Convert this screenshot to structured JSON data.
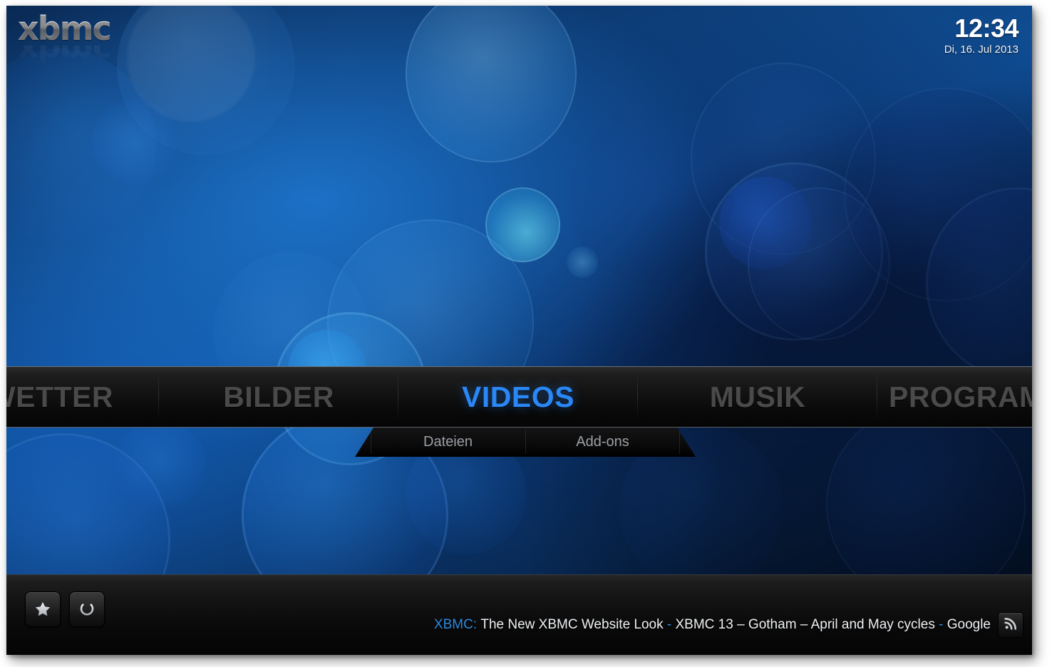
{
  "app": {
    "logo_text": "xbmc",
    "skin": "Confluence"
  },
  "header": {
    "clock_time": "12:34",
    "clock_date": "Di, 16. Jul 2013"
  },
  "main_menu": {
    "items": [
      {
        "label": "WETTER",
        "focused": false,
        "clipped_left": true
      },
      {
        "label": "BILDER",
        "focused": false
      },
      {
        "label": "VIDEOS",
        "focused": true
      },
      {
        "label": "MUSIK",
        "focused": false
      },
      {
        "label": "PROGRAMME",
        "focused": false,
        "clipped_right": true
      }
    ],
    "focused_label": "VIDEOS",
    "focus_color": "#2a87f5",
    "inactive_color": "#4a4a4a"
  },
  "submenu": {
    "items": [
      {
        "label": "Dateien"
      },
      {
        "label": "Add-ons"
      }
    ]
  },
  "footer": {
    "buttons": [
      {
        "name": "favourites",
        "icon": "star-icon"
      },
      {
        "name": "power",
        "icon": "power-icon"
      }
    ],
    "rss": {
      "source": "XBMC:",
      "headline_1": "The New XBMC Website Look",
      "separator": "-",
      "headline_2": "XBMC 13 – Gotham – April and May cycles",
      "headline_3": "Google",
      "icon": "rss-icon"
    }
  },
  "colors": {
    "accent_blue": "#2a87f5",
    "rss_blue": "#2f8ae0",
    "menu_bg_top": "#2a2a2a",
    "menu_bg_bottom": "#050505",
    "wallpaper_base": "#0f4f96"
  }
}
